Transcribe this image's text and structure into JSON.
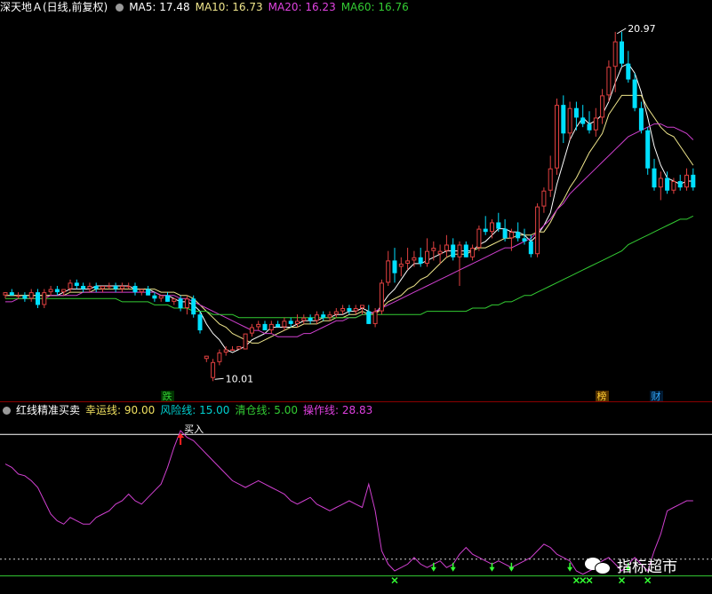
{
  "header": {
    "stock": "深天地Ａ(日线,前复权)",
    "ma5": "MA5: 17.48",
    "ma10": "MA10: 16.73",
    "ma20": "MA20: 16.23",
    "ma60": "MA60: 16.76"
  },
  "indicator_header": {
    "title": "红线精准买卖",
    "lucky": "幸运线: 90.00",
    "risk": "风险线: 15.00",
    "clear": "清仓线: 5.00",
    "op": "操作线: 28.83"
  },
  "watermark": "指标超市",
  "colors": {
    "up": "#e04040",
    "down": "#00e0ff",
    "ma5": "#ffffff",
    "ma10": "#f0e68c",
    "ma20": "#d040d0",
    "ma60": "#33cc33",
    "op_line": "#d040d0"
  },
  "chart_data": [
    {
      "type": "candlestick",
      "title": "深天地Ａ(日线,前复权)",
      "ylim": [
        9.6,
        21.4
      ],
      "annotations": {
        "high_label": "20.97",
        "low_label": "10.01",
        "marker_drop": "跌",
        "marker_list": "榜",
        "marker_fin": "财"
      },
      "candles": [
        [
          12.6,
          12.7,
          12.5,
          12.7
        ],
        [
          12.7,
          12.8,
          12.6,
          12.6
        ],
        [
          12.6,
          12.7,
          12.5,
          12.6
        ],
        [
          12.6,
          12.7,
          12.4,
          12.5
        ],
        [
          12.5,
          12.8,
          12.4,
          12.7
        ],
        [
          12.7,
          12.8,
          12.2,
          12.3
        ],
        [
          12.3,
          12.8,
          12.2,
          12.7
        ],
        [
          12.7,
          12.9,
          12.6,
          12.8
        ],
        [
          12.8,
          12.9,
          12.6,
          12.7
        ],
        [
          12.7,
          12.8,
          12.6,
          12.8
        ],
        [
          12.8,
          13.1,
          12.7,
          13.0
        ],
        [
          13.0,
          13.1,
          12.8,
          12.9
        ],
        [
          12.9,
          13.0,
          12.7,
          12.8
        ],
        [
          12.8,
          13.0,
          12.7,
          12.9
        ],
        [
          12.9,
          13.0,
          12.7,
          12.8
        ],
        [
          12.8,
          12.9,
          12.7,
          12.9
        ],
        [
          12.9,
          13.0,
          12.8,
          12.9
        ],
        [
          12.9,
          13.0,
          12.7,
          12.8
        ],
        [
          12.8,
          13.0,
          12.7,
          12.9
        ],
        [
          12.9,
          13.0,
          12.8,
          12.9
        ],
        [
          12.9,
          13.0,
          12.6,
          12.7
        ],
        [
          12.7,
          12.8,
          12.6,
          12.8
        ],
        [
          12.8,
          12.9,
          12.6,
          12.6
        ],
        [
          12.6,
          12.7,
          12.4,
          12.5
        ],
        [
          12.5,
          12.6,
          12.4,
          12.6
        ],
        [
          12.6,
          12.7,
          12.4,
          12.4
        ],
        [
          12.4,
          12.5,
          12.3,
          12.5
        ],
        [
          12.5,
          12.6,
          12.1,
          12.2
        ],
        [
          12.2,
          12.6,
          12.0,
          12.5
        ],
        [
          12.5,
          12.6,
          11.9,
          12.0
        ],
        [
          12.0,
          12.1,
          11.4,
          11.5
        ],
        [
          10.6,
          10.7,
          10.5,
          10.7
        ],
        [
          10.0,
          10.6,
          9.9,
          10.5
        ],
        [
          10.5,
          10.9,
          10.4,
          10.8
        ],
        [
          10.8,
          11.0,
          10.7,
          10.9
        ],
        [
          10.9,
          11.0,
          10.9,
          10.9
        ],
        [
          10.9,
          11.0,
          10.9,
          11.0
        ],
        [
          10.9,
          11.4,
          10.9,
          11.4
        ],
        [
          11.4,
          11.7,
          11.3,
          11.6
        ],
        [
          11.6,
          11.8,
          11.5,
          11.7
        ],
        [
          11.7,
          11.8,
          11.5,
          11.5
        ],
        [
          11.5,
          11.8,
          11.4,
          11.7
        ],
        [
          11.7,
          11.8,
          11.6,
          11.6
        ],
        [
          11.6,
          11.9,
          11.5,
          11.8
        ],
        [
          11.8,
          11.9,
          11.6,
          11.7
        ],
        [
          11.7,
          12.0,
          11.6,
          11.8
        ],
        [
          11.8,
          12.0,
          11.7,
          11.9
        ],
        [
          11.9,
          12.0,
          11.7,
          11.8
        ],
        [
          11.8,
          12.1,
          11.7,
          12.0
        ],
        [
          12.0,
          12.1,
          11.8,
          11.9
        ],
        [
          11.9,
          12.1,
          11.8,
          12.0
        ],
        [
          12.0,
          12.2,
          11.9,
          12.1
        ],
        [
          12.1,
          12.3,
          12.0,
          12.2
        ],
        [
          12.2,
          12.3,
          12.0,
          12.1
        ],
        [
          12.1,
          12.3,
          12.0,
          12.2
        ],
        [
          12.2,
          12.3,
          12.0,
          12.3
        ],
        [
          12.1,
          12.3,
          11.7,
          11.7
        ],
        [
          11.7,
          12.2,
          11.6,
          12.1
        ],
        [
          12.1,
          13.1,
          12.0,
          13.0
        ],
        [
          13.0,
          14.0,
          12.9,
          13.7
        ],
        [
          13.7,
          14.1,
          13.0,
          13.3
        ],
        [
          13.5,
          13.8,
          13.2,
          13.6
        ],
        [
          13.6,
          14.1,
          13.4,
          13.7
        ],
        [
          13.7,
          14.0,
          13.5,
          13.8
        ],
        [
          13.8,
          14.1,
          13.5,
          13.6
        ],
        [
          13.6,
          14.4,
          13.5,
          14.0
        ],
        [
          14.0,
          14.3,
          13.7,
          14.1
        ],
        [
          13.9,
          14.2,
          13.6,
          14.0
        ],
        [
          14.0,
          14.5,
          13.8,
          14.2
        ],
        [
          14.2,
          14.4,
          13.7,
          13.8
        ],
        [
          13.8,
          14.3,
          12.9,
          14.2
        ],
        [
          14.2,
          14.3,
          13.8,
          13.8
        ],
        [
          13.8,
          14.2,
          13.7,
          14.1
        ],
        [
          14.1,
          14.8,
          14.0,
          14.7
        ],
        [
          14.7,
          15.1,
          14.5,
          14.6
        ],
        [
          14.6,
          15.0,
          14.4,
          14.9
        ],
        [
          14.9,
          15.2,
          14.6,
          14.7
        ],
        [
          14.7,
          15.0,
          14.3,
          14.4
        ],
        [
          14.4,
          14.7,
          14.0,
          14.6
        ],
        [
          14.6,
          14.9,
          14.3,
          14.4
        ],
        [
          14.4,
          14.7,
          14.2,
          14.3
        ],
        [
          14.3,
          14.5,
          13.8,
          13.9
        ],
        [
          13.9,
          15.5,
          13.8,
          15.4
        ],
        [
          15.4,
          16.0,
          15.2,
          15.9
        ],
        [
          15.9,
          17.0,
          15.7,
          16.6
        ],
        [
          16.6,
          18.8,
          16.4,
          18.6
        ],
        [
          18.6,
          18.9,
          17.4,
          17.7
        ],
        [
          17.7,
          18.7,
          17.5,
          18.5
        ],
        [
          18.5,
          18.7,
          17.8,
          18.2
        ],
        [
          18.2,
          18.6,
          17.9,
          18.0
        ],
        [
          18.0,
          18.4,
          17.7,
          17.8
        ],
        [
          17.8,
          18.5,
          17.6,
          18.2
        ],
        [
          18.2,
          19.1,
          18.0,
          18.9
        ],
        [
          18.9,
          20.0,
          18.7,
          19.8
        ],
        [
          19.8,
          20.9,
          19.0,
          20.6
        ],
        [
          20.6,
          20.9,
          19.8,
          19.9
        ],
        [
          19.9,
          20.3,
          19.3,
          19.4
        ],
        [
          19.4,
          19.6,
          18.4,
          18.5
        ],
        [
          18.5,
          18.7,
          17.7,
          17.8
        ],
        [
          17.8,
          17.9,
          16.4,
          16.6
        ],
        [
          16.6,
          16.9,
          15.9,
          16.0
        ],
        [
          16.0,
          16.5,
          15.6,
          16.3
        ],
        [
          16.3,
          16.5,
          15.8,
          15.9
        ],
        [
          15.9,
          16.3,
          15.8,
          16.2
        ],
        [
          16.2,
          16.4,
          15.9,
          16.0
        ],
        [
          16.0,
          16.6,
          15.9,
          16.4
        ],
        [
          16.4,
          16.6,
          15.9,
          16.0
        ]
      ],
      "series": [
        {
          "name": "MA5",
          "values": [
            12.6,
            12.6,
            12.6,
            12.6,
            12.6,
            12.6,
            12.6,
            12.6,
            12.6,
            12.7,
            12.8,
            12.8,
            12.8,
            12.8,
            12.9,
            12.9,
            12.9,
            12.9,
            12.9,
            12.9,
            12.8,
            12.8,
            12.8,
            12.7,
            12.6,
            12.6,
            12.5,
            12.4,
            12.4,
            12.3,
            12.1,
            11.7,
            11.4,
            11.2,
            10.9,
            10.8,
            10.9,
            11.0,
            11.2,
            11.3,
            11.4,
            11.6,
            11.6,
            11.6,
            11.6,
            11.7,
            11.8,
            11.8,
            11.8,
            11.9,
            11.9,
            12.0,
            12.0,
            12.1,
            12.1,
            12.2,
            12.1,
            12.0,
            12.3,
            12.6,
            12.8,
            13.1,
            13.4,
            13.6,
            13.6,
            13.7,
            13.8,
            13.9,
            14.0,
            14.0,
            14.0,
            14.0,
            14.0,
            14.2,
            14.3,
            14.5,
            14.7,
            14.7,
            14.6,
            14.6,
            14.5,
            14.3,
            14.5,
            14.8,
            15.2,
            16.1,
            16.8,
            17.5,
            17.9,
            18.2,
            18.0,
            18.1,
            18.3,
            18.7,
            19.3,
            19.8,
            19.9,
            19.6,
            19.0,
            18.2,
            17.3,
            16.7,
            16.3,
            16.2,
            16.1,
            16.2,
            16.2
          ]
        },
        {
          "name": "MA10",
          "values": [
            12.6,
            12.6,
            12.6,
            12.6,
            12.6,
            12.6,
            12.6,
            12.6,
            12.6,
            12.6,
            12.7,
            12.7,
            12.7,
            12.7,
            12.8,
            12.8,
            12.8,
            12.8,
            12.8,
            12.8,
            12.8,
            12.8,
            12.8,
            12.8,
            12.7,
            12.7,
            12.7,
            12.6,
            12.6,
            12.5,
            12.3,
            12.1,
            11.9,
            11.7,
            11.6,
            11.4,
            11.3,
            11.2,
            11.1,
            11.1,
            11.2,
            11.3,
            11.4,
            11.5,
            11.6,
            11.6,
            11.7,
            11.7,
            11.7,
            11.8,
            11.8,
            11.9,
            11.9,
            12.0,
            12.0,
            12.1,
            12.0,
            12.0,
            12.2,
            12.4,
            12.5,
            12.6,
            12.8,
            12.9,
            13.1,
            13.2,
            13.4,
            13.6,
            13.8,
            13.9,
            13.9,
            13.9,
            14.0,
            14.1,
            14.1,
            14.2,
            14.3,
            14.4,
            14.4,
            14.5,
            14.5,
            14.5,
            14.6,
            14.6,
            14.9,
            15.3,
            15.6,
            16.0,
            16.3,
            16.7,
            17.1,
            17.4,
            17.7,
            18.3,
            18.6,
            18.9,
            18.9,
            18.9,
            18.9,
            18.5,
            18.2,
            17.9,
            17.7,
            17.6,
            17.3,
            17.0,
            16.7
          ]
        },
        {
          "name": "MA20",
          "values": [
            12.4,
            12.4,
            12.5,
            12.5,
            12.5,
            12.5,
            12.5,
            12.6,
            12.6,
            12.6,
            12.6,
            12.6,
            12.7,
            12.7,
            12.7,
            12.7,
            12.7,
            12.7,
            12.7,
            12.7,
            12.7,
            12.7,
            12.7,
            12.7,
            12.6,
            12.6,
            12.6,
            12.5,
            12.5,
            12.4,
            12.3,
            12.2,
            12.1,
            12.0,
            11.9,
            11.8,
            11.7,
            11.6,
            11.5,
            11.5,
            11.4,
            11.4,
            11.3,
            11.3,
            11.3,
            11.3,
            11.4,
            11.4,
            11.5,
            11.6,
            11.7,
            11.8,
            11.8,
            11.9,
            11.9,
            12.0,
            12.0,
            12.1,
            12.2,
            12.3,
            12.4,
            12.5,
            12.6,
            12.7,
            12.8,
            12.9,
            13.0,
            13.1,
            13.2,
            13.3,
            13.4,
            13.5,
            13.6,
            13.7,
            13.8,
            13.9,
            14.0,
            14.1,
            14.1,
            14.2,
            14.3,
            14.4,
            14.6,
            14.8,
            15.0,
            15.3,
            15.5,
            15.8,
            16.0,
            16.2,
            16.4,
            16.6,
            16.8,
            17.0,
            17.2,
            17.4,
            17.6,
            17.7,
            17.8,
            17.9,
            18.0,
            18.0,
            17.9,
            17.9,
            17.8,
            17.7,
            17.5
          ]
        },
        {
          "name": "MA60",
          "values": [
            12.5,
            12.5,
            12.5,
            12.5,
            12.5,
            12.5,
            12.5,
            12.5,
            12.5,
            12.5,
            12.5,
            12.5,
            12.5,
            12.5,
            12.5,
            12.5,
            12.5,
            12.5,
            12.4,
            12.4,
            12.4,
            12.4,
            12.4,
            12.3,
            12.3,
            12.3,
            12.2,
            12.2,
            12.2,
            12.1,
            12.1,
            12.1,
            12.0,
            12.0,
            12.0,
            12.0,
            11.9,
            11.9,
            11.9,
            11.9,
            11.9,
            11.9,
            11.9,
            11.9,
            11.9,
            11.9,
            11.9,
            11.9,
            11.9,
            11.9,
            11.9,
            11.9,
            11.9,
            11.9,
            11.9,
            12.0,
            12.0,
            12.0,
            12.0,
            12.0,
            12.0,
            12.0,
            12.0,
            12.0,
            12.0,
            12.1,
            12.1,
            12.1,
            12.1,
            12.1,
            12.1,
            12.1,
            12.2,
            12.2,
            12.2,
            12.3,
            12.3,
            12.4,
            12.4,
            12.5,
            12.6,
            12.6,
            12.7,
            12.8,
            12.9,
            13.0,
            13.1,
            13.2,
            13.3,
            13.4,
            13.5,
            13.6,
            13.7,
            13.8,
            13.9,
            14.0,
            14.2,
            14.3,
            14.4,
            14.5,
            14.6,
            14.7,
            14.8,
            14.9,
            15.0,
            15.0,
            15.1
          ]
        }
      ]
    },
    {
      "type": "line",
      "title": "红线精准买卖",
      "ylim": [
        0,
        100
      ],
      "levels": {
        "lucky": 90,
        "risk": 15,
        "clear": 5
      },
      "buy_label": "买入",
      "series": [
        {
          "name": "操作线",
          "values": [
            72,
            70,
            66,
            65,
            62,
            58,
            50,
            42,
            38,
            36,
            40,
            38,
            36,
            36,
            40,
            42,
            44,
            48,
            50,
            54,
            50,
            48,
            52,
            56,
            60,
            70,
            82,
            92,
            88,
            86,
            82,
            78,
            74,
            70,
            66,
            62,
            60,
            58,
            60,
            62,
            60,
            58,
            56,
            54,
            50,
            48,
            50,
            52,
            48,
            46,
            44,
            46,
            48,
            50,
            48,
            46,
            60,
            44,
            20,
            12,
            8,
            10,
            12,
            16,
            12,
            10,
            12,
            14,
            10,
            12,
            18,
            22,
            18,
            16,
            14,
            12,
            14,
            12,
            10,
            12,
            14,
            16,
            20,
            24,
            22,
            18,
            16,
            14,
            8,
            6,
            8,
            10,
            14,
            16,
            12,
            8,
            12,
            16,
            12,
            8,
            20,
            30,
            44,
            46,
            48,
            50,
            50
          ]
        }
      ]
    }
  ]
}
